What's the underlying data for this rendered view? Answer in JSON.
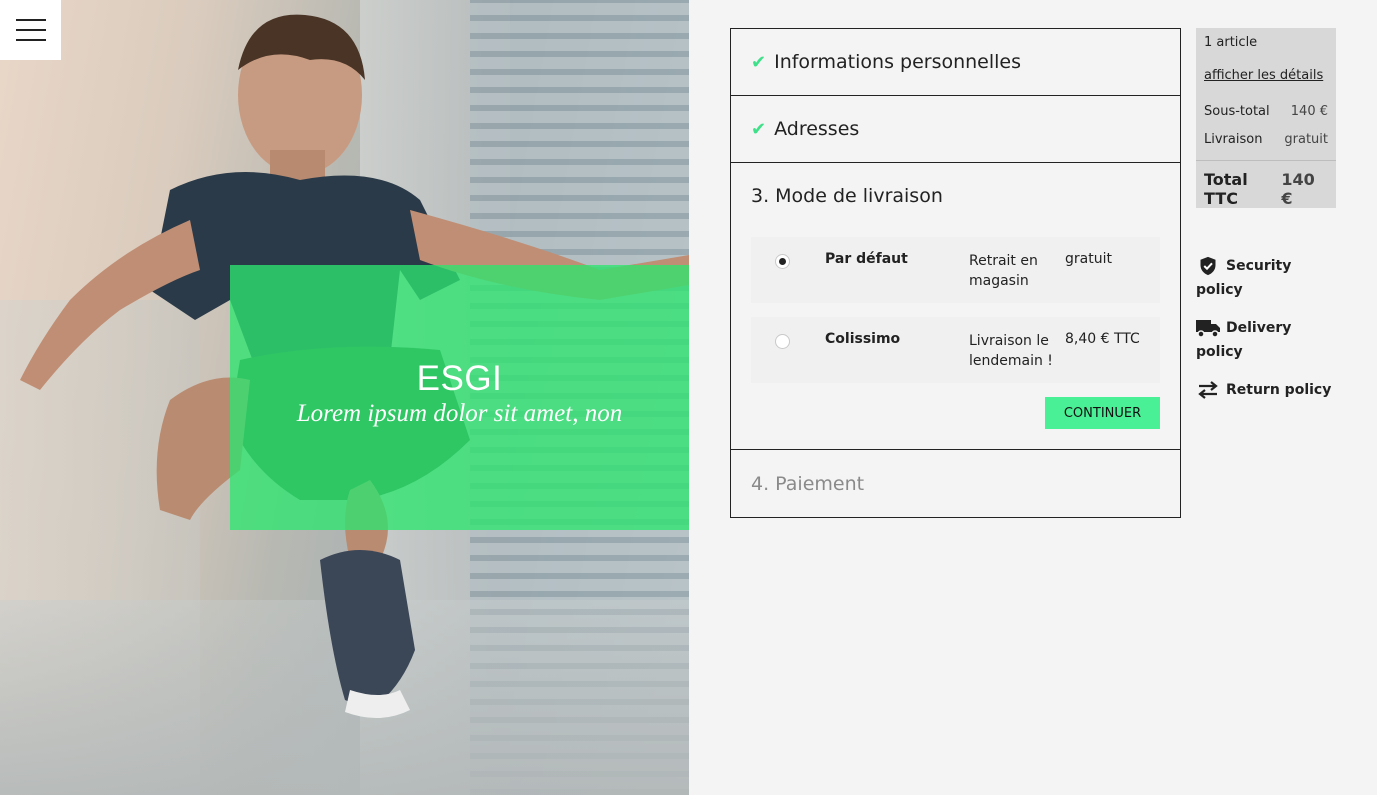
{
  "header": {
    "menu_icon": "hamburger-menu-icon"
  },
  "promo": {
    "title": "ESGI",
    "subtitle": "Lorem ipsum dolor sit amet, non"
  },
  "checkout": {
    "steps": [
      {
        "label": "Informations personnelles",
        "status": "done",
        "icon": "check-icon"
      },
      {
        "label": "Adresses",
        "status": "done",
        "icon": "check-icon"
      },
      {
        "label": "3. Mode de livraison",
        "status": "active"
      },
      {
        "label": "4. Paiement",
        "status": "disabled"
      }
    ],
    "shipping_options": [
      {
        "name": "Par défaut",
        "description": "Retrait en magasin",
        "price": "gratuit",
        "selected": true
      },
      {
        "name": "Colissimo",
        "description": "Livraison le lendemain !",
        "price": "8,40 € TTC",
        "selected": false
      }
    ],
    "continue_label": "CONTINUER"
  },
  "summary": {
    "count": "1 article",
    "details_link": "afficher les détails",
    "subtotal_label": "Sous-total",
    "subtotal_value": "140 €",
    "shipping_label": "Livraison",
    "shipping_value": "gratuit",
    "total_label": "Total TTC",
    "total_value": "140 €"
  },
  "policies": [
    {
      "label": "Security policy",
      "icon": "shield-check-icon"
    },
    {
      "label": "Delivery policy",
      "icon": "truck-icon"
    },
    {
      "label": "Return policy",
      "icon": "exchange-arrows-icon"
    }
  ],
  "colors": {
    "accent": "#4af096",
    "check": "#3fe08a",
    "promo_overlay": "#2ee670",
    "background": "#f4f4f4",
    "summary_bg": "#d8d8d8"
  }
}
